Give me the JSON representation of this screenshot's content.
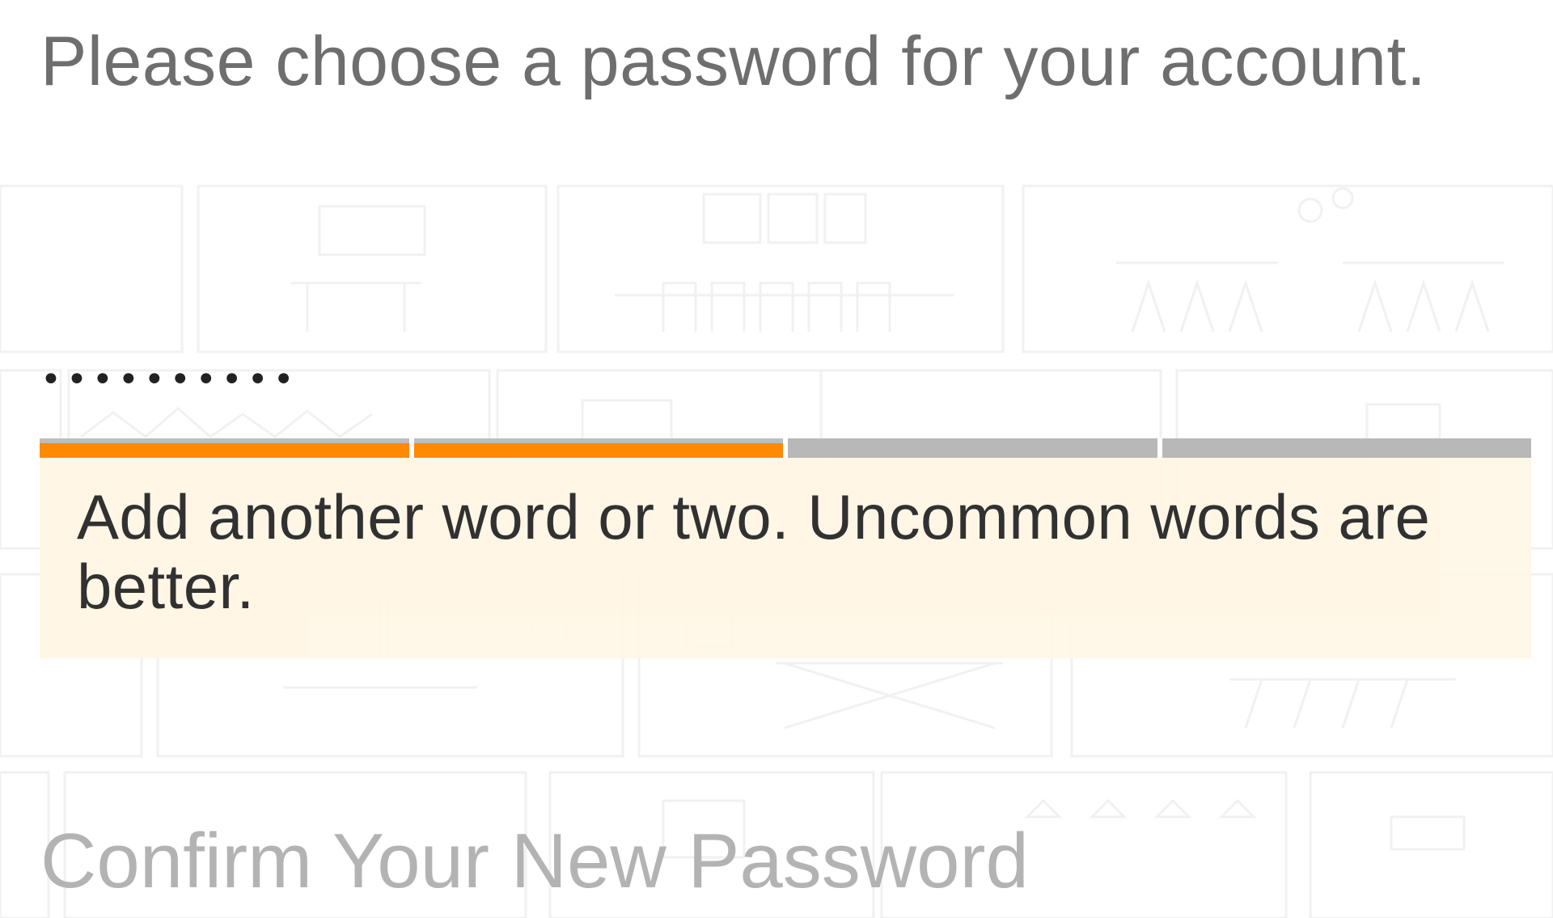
{
  "instructions_text": "Please choose a password for your account.",
  "password": {
    "masked_value": "••••••••••",
    "strength": {
      "filled_segments": 2,
      "total_segments": 4,
      "fill_color": "#ff8a00",
      "empty_color": "#b8b8b8"
    },
    "feedback": "Add another word or two. Uncommon words are better."
  },
  "confirm": {
    "placeholder": "Confirm Your New Password"
  },
  "colors": {
    "feedback_background": "#fff6e5",
    "instructions_text": "#6e6e6e",
    "placeholder_text": "#b3b3b3"
  }
}
